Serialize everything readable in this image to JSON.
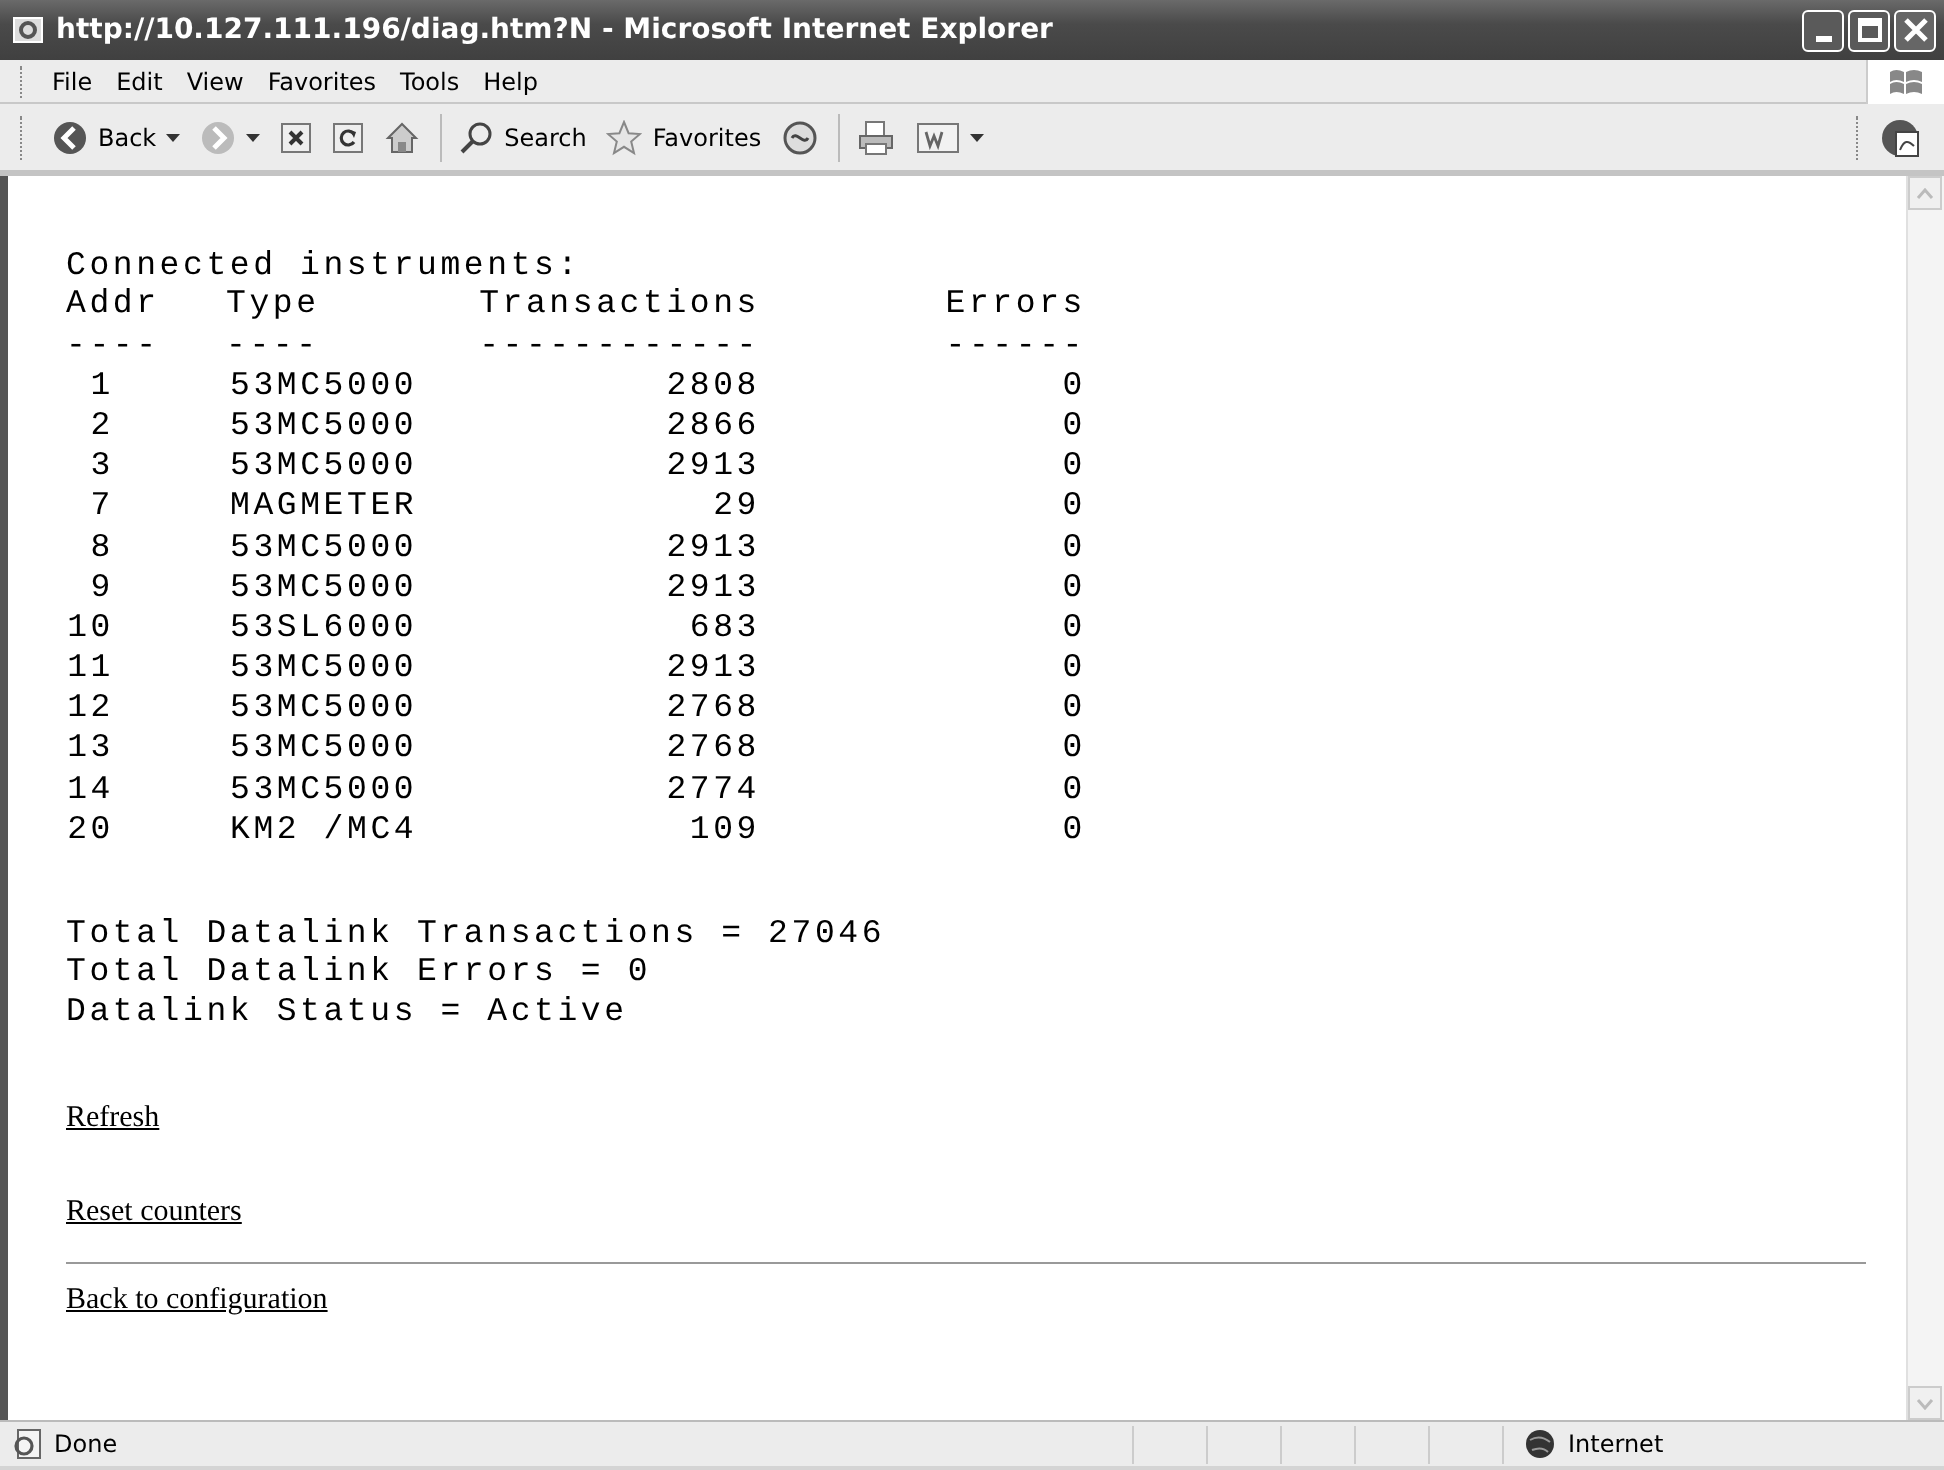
{
  "window": {
    "title": "http://10.127.111.196/diag.htm?N - Microsoft Internet Explorer"
  },
  "menu": [
    "File",
    "Edit",
    "View",
    "Favorites",
    "Tools",
    "Help"
  ],
  "toolbar": [
    {
      "kind": "back",
      "label": "Back"
    },
    {
      "kind": "forward"
    },
    {
      "kind": "stop"
    },
    {
      "kind": "refresh"
    },
    {
      "kind": "home"
    },
    {
      "kind": "search",
      "label": "Search"
    },
    {
      "kind": "favorites",
      "label": "Favorites"
    },
    {
      "kind": "media"
    },
    {
      "kind": "print"
    },
    {
      "kind": "word"
    }
  ],
  "page": {
    "heading": "Connected instruments:",
    "columns": [
      {
        "label": "Addr",
        "rule": "----"
      },
      {
        "label": "Type",
        "rule": "----"
      },
      {
        "label": "Transactions",
        "rule": "------------"
      },
      {
        "label": "Errors",
        "rule": "------"
      }
    ],
    "rows": [
      {
        "addr": "1",
        "type": "53MC5000",
        "transactions": "2808",
        "errors": "0"
      },
      {
        "addr": "2",
        "type": "53MC5000",
        "transactions": "2866",
        "errors": "0"
      },
      {
        "addr": "3",
        "type": "53MC5000",
        "transactions": "2913",
        "errors": "0"
      },
      {
        "addr": "7",
        "type": "MAGMETER",
        "transactions": "29",
        "errors": "0"
      },
      {
        "addr": "8",
        "type": "53MC5000",
        "transactions": "2913",
        "errors": "0"
      },
      {
        "addr": "9",
        "type": "53MC5000",
        "transactions": "2913",
        "errors": "0"
      },
      {
        "addr": "10",
        "type": "53SL6000",
        "transactions": "683",
        "errors": "0"
      },
      {
        "addr": "11",
        "type": "53MC5000",
        "transactions": "2913",
        "errors": "0"
      },
      {
        "addr": "12",
        "type": "53MC5000",
        "transactions": "2768",
        "errors": "0"
      },
      {
        "addr": "13",
        "type": "53MC5000",
        "transactions": "2768",
        "errors": "0"
      },
      {
        "addr": "14",
        "type": "53MC5000",
        "transactions": "2774",
        "errors": "0"
      },
      {
        "addr": "20",
        "type": "KM2 /MC4",
        "transactions": "109",
        "errors": "0"
      }
    ],
    "summary": [
      "Total Datalink Transactions = 27046",
      "Total Datalink Errors = 0",
      "Datalink Status = Active"
    ],
    "links": [
      "Refresh",
      "Reset counters"
    ],
    "footer_link": "Back to configuration"
  },
  "status_bar": {
    "text": "Done",
    "zone": "Internet"
  }
}
